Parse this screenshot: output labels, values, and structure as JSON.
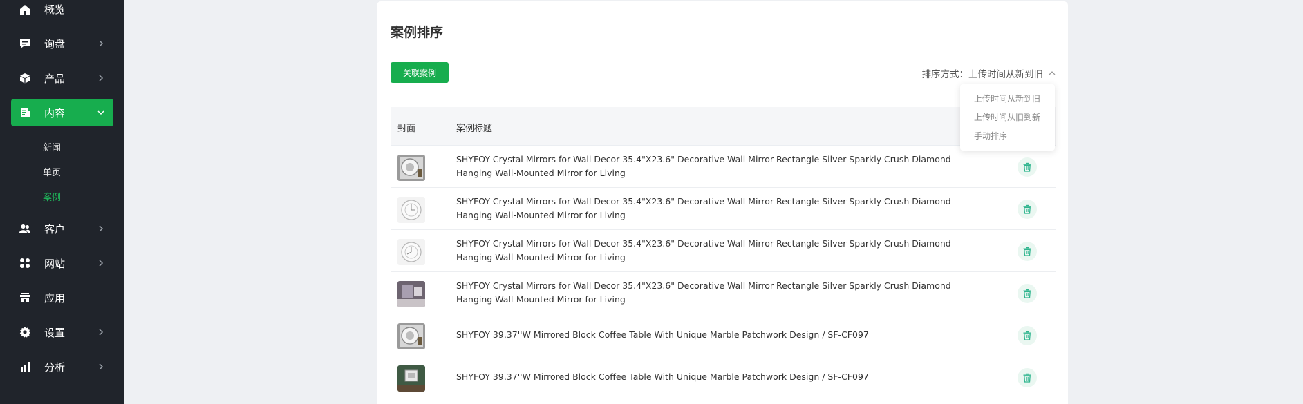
{
  "sidebar": {
    "items": [
      {
        "label": "概览",
        "icon": "home-icon"
      },
      {
        "label": "询盘",
        "icon": "message-icon"
      },
      {
        "label": "产品",
        "icon": "box-icon"
      },
      {
        "label": "内容",
        "icon": "document-icon"
      },
      {
        "label": "客户",
        "icon": "users-icon"
      },
      {
        "label": "网站",
        "icon": "grid-icon"
      },
      {
        "label": "应用",
        "icon": "store-icon"
      },
      {
        "label": "设置",
        "icon": "gear-icon"
      },
      {
        "label": "分析",
        "icon": "chart-icon"
      }
    ],
    "content_sub": [
      {
        "label": "新闻"
      },
      {
        "label": "单页"
      },
      {
        "label": "案例"
      }
    ],
    "active_item": "内容",
    "active_sub": "案例"
  },
  "page": {
    "title": "案例排序",
    "link_button": "关联案例",
    "sort_label": "排序方式：上传时间从新到旧"
  },
  "table": {
    "columns": [
      "封面",
      "案例标题"
    ],
    "rows": [
      {
        "title": "SHYFOY Crystal Mirrors for Wall Decor 35.4\"X23.6\" Decorative Wall Mirror Rectangle Silver Sparkly Crush Diamond Hanging Wall-Mounted Mirror for Living"
      },
      {
        "title": "SHYFOY Crystal Mirrors for Wall Decor 35.4\"X23.6\" Decorative Wall Mirror Rectangle Silver Sparkly Crush Diamond Hanging Wall-Mounted Mirror for Living"
      },
      {
        "title": "SHYFOY Crystal Mirrors for Wall Decor 35.4\"X23.6\" Decorative Wall Mirror Rectangle Silver Sparkly Crush Diamond Hanging Wall-Mounted Mirror for Living"
      },
      {
        "title": "SHYFOY Crystal Mirrors for Wall Decor 35.4\"X23.6\" Decorative Wall Mirror Rectangle Silver Sparkly Crush Diamond Hanging Wall-Mounted Mirror for Living"
      },
      {
        "title": "SHYFOY 39.37''W Mirrored Block Coffee Table With Unique Marble Patchwork Design / SF-CF097"
      },
      {
        "title": "SHYFOY 39.37''W Mirrored Block Coffee Table With Unique Marble Patchwork Design / SF-CF097"
      }
    ]
  },
  "sort_menu": {
    "options": [
      "上传时间从新到旧",
      "上传时间从旧到新",
      "手动排序"
    ]
  },
  "colors": {
    "accent": "#17ad4e",
    "sidebar_bg": "#20242b",
    "page_bg": "#eef0f3"
  }
}
